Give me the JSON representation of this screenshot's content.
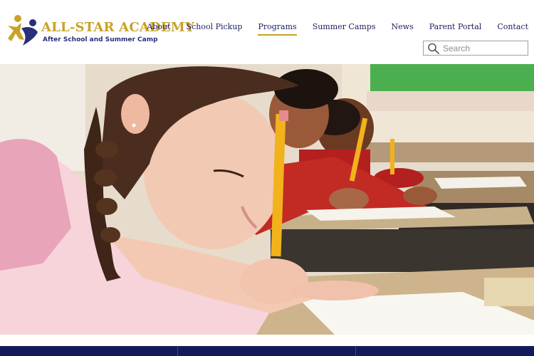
{
  "brand": {
    "title": "ALL-STAR ACADEMY",
    "subtitle": "After School and Summer Camp",
    "logo_icon": "star-figure-logo-icon",
    "gold": "#c9a227",
    "navy": "#1c1f5e"
  },
  "nav": {
    "items": [
      {
        "label": "About",
        "active": false
      },
      {
        "label": "School Pickup",
        "active": false
      },
      {
        "label": "Programs",
        "active": true
      },
      {
        "label": "Summer Camps",
        "active": false
      },
      {
        "label": "News",
        "active": false
      },
      {
        "label": "Parent Portal",
        "active": false
      },
      {
        "label": "Contact",
        "active": false
      }
    ]
  },
  "search": {
    "placeholder": "Search",
    "value": "",
    "icon": "search-icon"
  },
  "hero": {
    "image": "children-writing-at-desks-photo"
  },
  "band": {
    "color": "#131a5c"
  }
}
